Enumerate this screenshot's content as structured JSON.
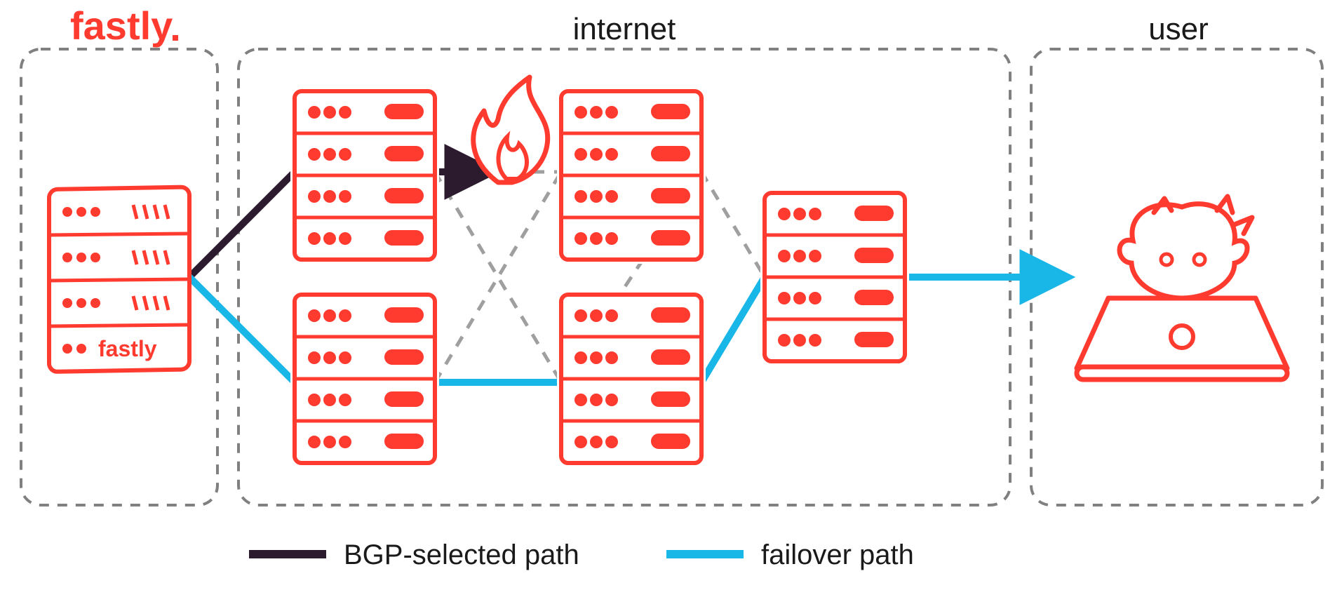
{
  "sections": {
    "fastly_label": "fastly",
    "fastly_server_label": "fastly",
    "internet_label": "internet",
    "user_label": "user"
  },
  "legend": {
    "bgp_label": "BGP-selected path",
    "failover_label": "failover path"
  },
  "colors": {
    "red": "#ff3b30",
    "bgp": "#2c1b2e",
    "failover": "#19b6e8",
    "dashed": "#9f9f9f",
    "box": "#808080"
  }
}
